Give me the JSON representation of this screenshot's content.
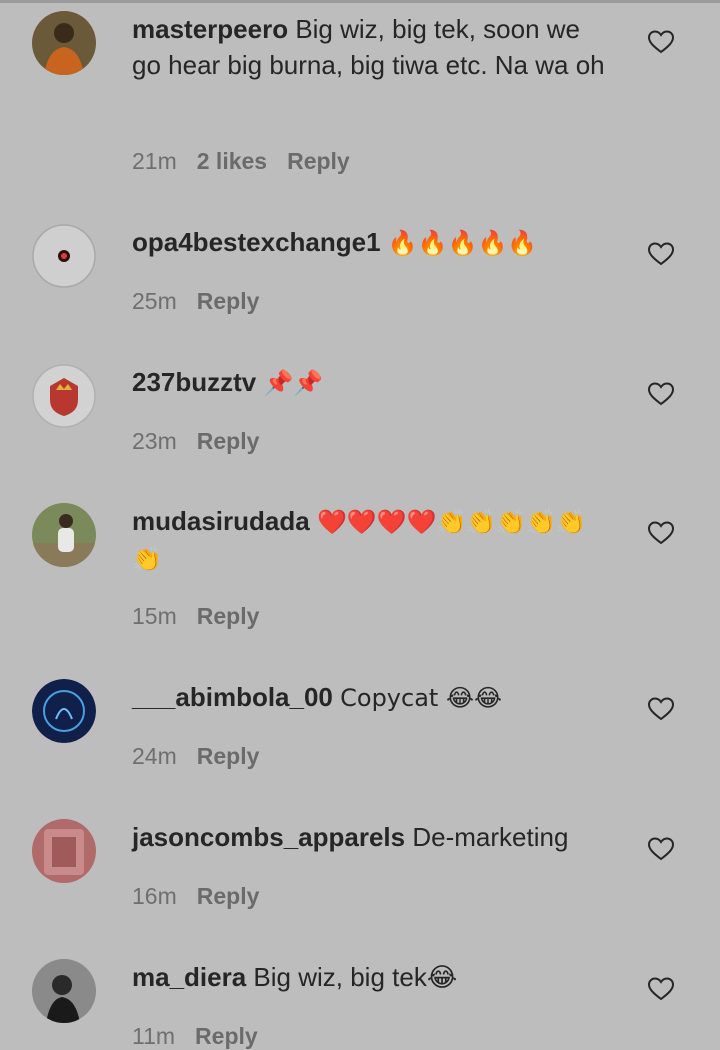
{
  "comments": [
    {
      "username": "masterpeero",
      "text": "Big wiz, big tek, soon we go hear big burna, big tiwa etc. Na wa oh",
      "time": "21m",
      "likes": "2 likes",
      "reply": "Reply"
    },
    {
      "username": "opa4bestexchange1",
      "text": "🔥🔥🔥🔥🔥",
      "time": "25m",
      "reply": "Reply"
    },
    {
      "username": "237buzztv",
      "text": "📌📌",
      "time": "23m",
      "reply": "Reply"
    },
    {
      "username": "mudasirudada",
      "text": "❤️❤️❤️❤️👏👏👏👏👏👏",
      "time": "15m",
      "reply": "Reply"
    },
    {
      "username": "___abimbola_00",
      "text": "Copycat 😂😂",
      "time": "24m",
      "reply": "Reply"
    },
    {
      "username": "jasoncombs_apparels",
      "text": "De-marketing",
      "time": "16m",
      "reply": "Reply"
    },
    {
      "username": "ma_diera",
      "text": "Big wiz, big tek😂",
      "time": "11m",
      "reply": "Reply"
    }
  ],
  "icons": {
    "like": "heart-outline-icon"
  },
  "colors": {
    "background": "#bdbdbd",
    "text": "#262626",
    "meta": "#6f6f6f"
  }
}
